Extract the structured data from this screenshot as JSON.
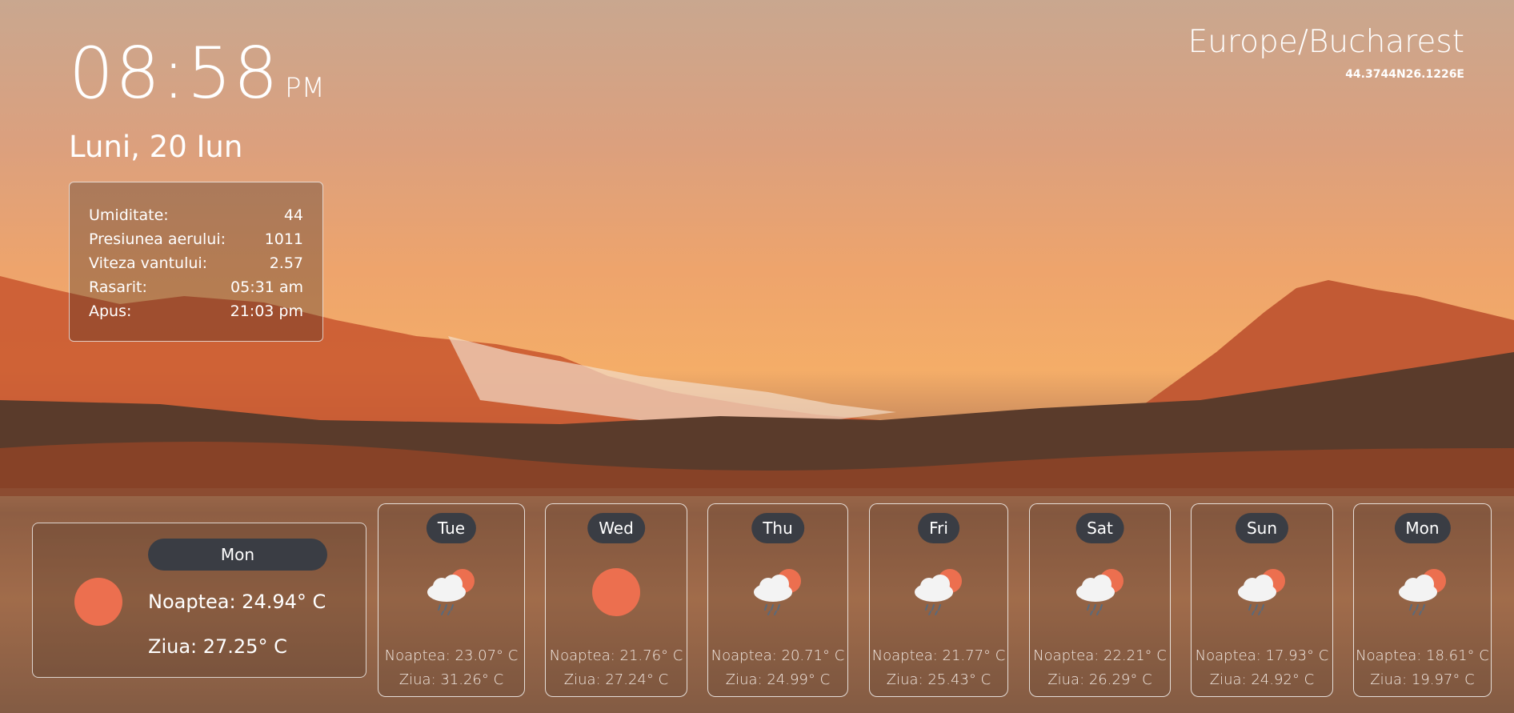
{
  "clock": {
    "time": "08:58",
    "ampm": "PM",
    "date": "Luni, 20 Iun"
  },
  "location": {
    "timezone": "Europe/Bucharest",
    "coords": "44.3744N26.1226E"
  },
  "details": [
    {
      "label": "Umiditate:",
      "value": "44"
    },
    {
      "label": "Presiunea aerului:",
      "value": "1011"
    },
    {
      "label": "Viteza vantului:",
      "value": "2.57"
    },
    {
      "label": "Rasarit:",
      "value": "05:31 am"
    },
    {
      "label": "Apus:",
      "value": "21:03 pm"
    }
  ],
  "today": {
    "day": "Mon",
    "icon": "sun-icon",
    "night": "Noaptea: 24.94° C",
    "day_temp": "Ziua: 27.25° C"
  },
  "forecast": [
    {
      "day": "Tue",
      "icon": "rain-cloud-sun-icon",
      "night": "Noaptea: 23.07° C",
      "day_temp": "Ziua: 31.26° C"
    },
    {
      "day": "Wed",
      "icon": "sun-icon",
      "night": "Noaptea: 21.76° C",
      "day_temp": "Ziua: 27.24° C"
    },
    {
      "day": "Thu",
      "icon": "rain-cloud-sun-icon",
      "night": "Noaptea: 20.71° C",
      "day_temp": "Ziua: 24.99° C"
    },
    {
      "day": "Fri",
      "icon": "rain-cloud-sun-icon",
      "night": "Noaptea: 21.77° C",
      "day_temp": "Ziua: 25.43° C"
    },
    {
      "day": "Sat",
      "icon": "rain-cloud-sun-icon",
      "night": "Noaptea: 22.21° C",
      "day_temp": "Ziua: 26.29° C"
    },
    {
      "day": "Sun",
      "icon": "rain-cloud-sun-icon",
      "night": "Noaptea: 17.93° C",
      "day_temp": "Ziua: 24.92° C"
    },
    {
      "day": "Mon",
      "icon": "rain-cloud-sun-icon",
      "night": "Noaptea: 18.61° C",
      "day_temp": "Ziua: 19.97° C"
    }
  ],
  "colors": {
    "sun": "#ec6f4f",
    "pill": "#3a3d44"
  }
}
